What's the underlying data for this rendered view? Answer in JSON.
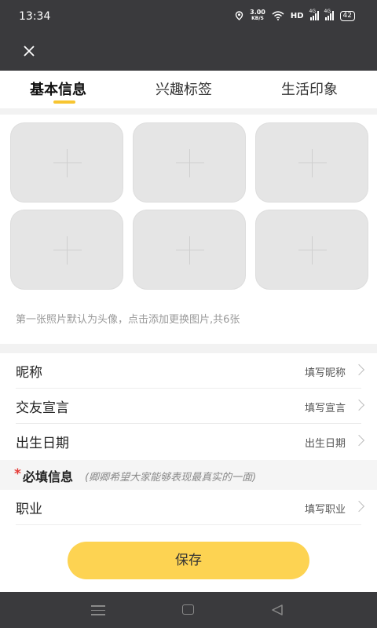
{
  "status_bar": {
    "time": "13:34",
    "net_speed_value": "3.00",
    "net_speed_unit": "KB/S",
    "hd_label": "HD",
    "signal_1_label": "4G",
    "signal_2_label": "4G",
    "battery": "42"
  },
  "header": {
    "close_icon": "close-icon"
  },
  "tabs": [
    {
      "label": "基本信息",
      "active": true
    },
    {
      "label": "兴趣标签",
      "active": false
    },
    {
      "label": "生活印象",
      "active": false
    }
  ],
  "accent_color": "#f7c531",
  "photos": {
    "slot_count": 6,
    "hint": "第一张照片默认为头像，点击添加更换图片,共6张"
  },
  "form": {
    "nickname": {
      "label": "昵称",
      "placeholder": "填写昵称"
    },
    "declaration": {
      "label": "交友宣言",
      "placeholder": "填写宣言"
    },
    "birthday": {
      "label": "出生日期",
      "placeholder": "出生日期"
    },
    "required": {
      "star": "*",
      "title": "必填信息",
      "note": "(卿卿希望大家能够表现最真实的一面)"
    },
    "occupation": {
      "label": "职业",
      "placeholder": "填写职业"
    }
  },
  "save_button": {
    "label": "保存",
    "color": "#fdd352"
  },
  "nav_bar": {
    "icons": [
      "menu-icon",
      "home-icon",
      "back-icon"
    ]
  }
}
